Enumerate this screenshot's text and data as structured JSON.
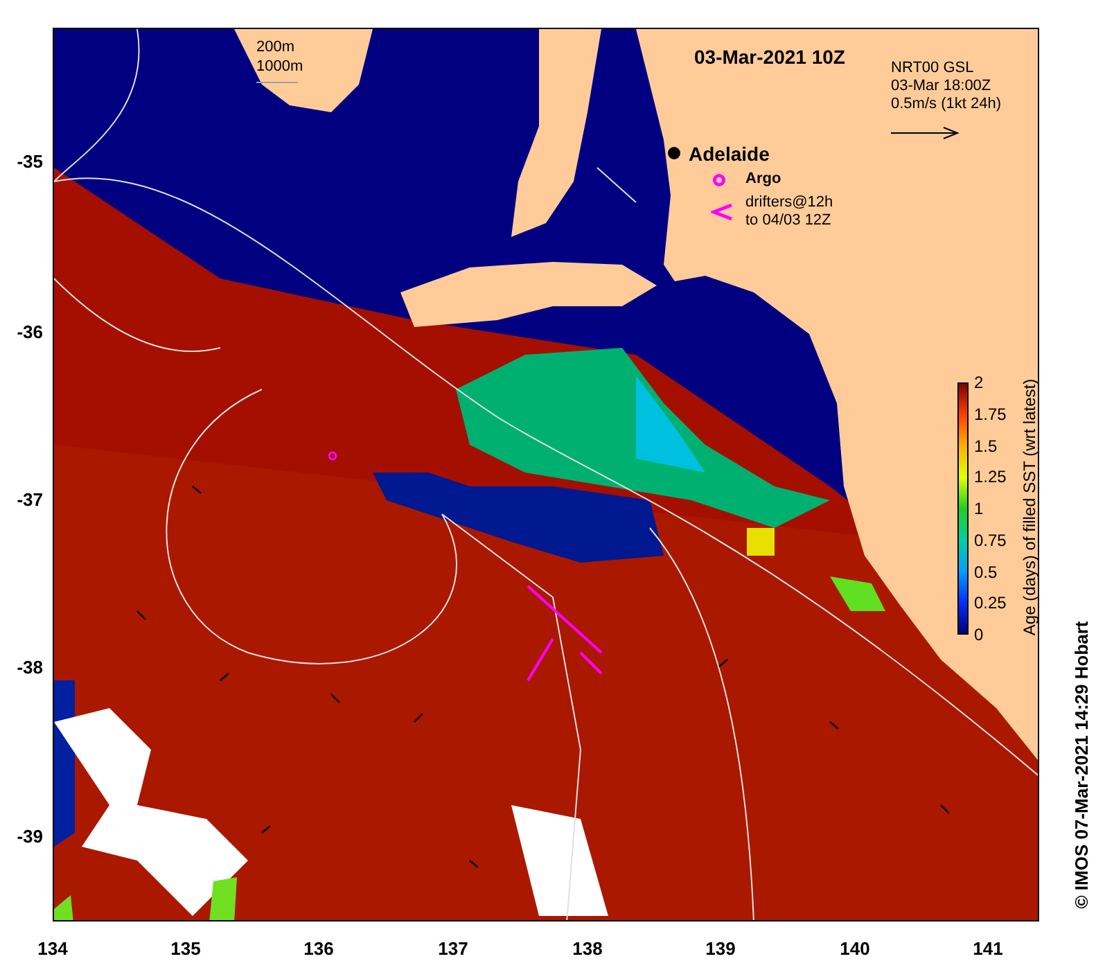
{
  "map": {
    "title": "03-Mar-2021 10Z",
    "contour_legend": [
      "200m",
      "1000m"
    ],
    "current_legend": [
      "NRT00 GSL",
      "03-Mar 18:00Z",
      "0.5m/s (1kt 24h)"
    ],
    "place": "Adelaide",
    "legend": [
      {
        "kind": "argo",
        "lines": [
          "Argo"
        ]
      },
      {
        "kind": "drifter",
        "lines": [
          "drifters@12h",
          "to 04/03 12Z"
        ]
      }
    ]
  },
  "colorbar": {
    "title": "Age (days) of filled SST (wrt latest)",
    "ticks": [
      "2",
      "1.75",
      "1.5",
      "1.25",
      "1",
      "0.75",
      "0.5",
      "0.25",
      "0"
    ]
  },
  "axes": {
    "y_ticks": [
      "-35",
      "-36",
      "-37",
      "-38",
      "-39"
    ],
    "x_ticks": [
      "134",
      "135",
      "136",
      "137",
      "138",
      "139",
      "140",
      "141"
    ]
  },
  "credit": "© IMOS 07-Mar-2021 14:29 Hobart"
}
